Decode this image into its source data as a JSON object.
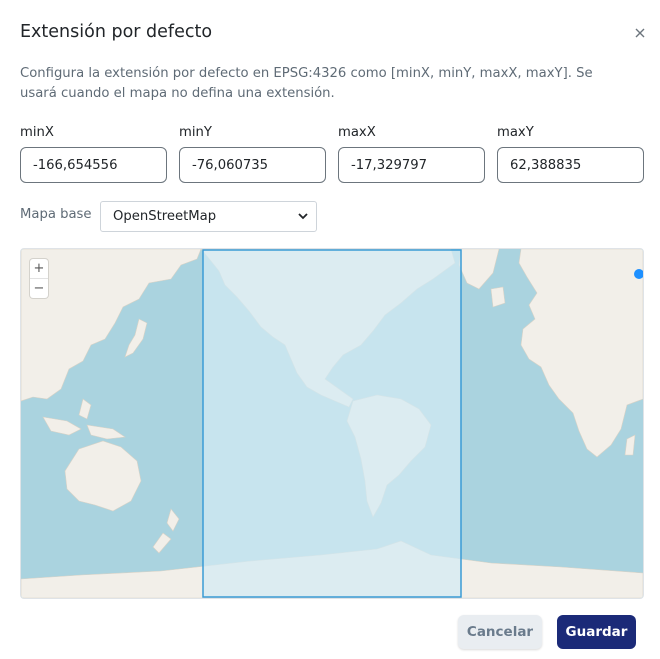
{
  "dialog": {
    "title": "Extensión por defecto",
    "description": "Configura la extensión por defecto en EPSG:4326 como [minX, minY, maxX, maxY]. Se usará cuando el mapa no defina una extensión."
  },
  "fields": [
    {
      "label": "minX",
      "value": "-166,654556"
    },
    {
      "label": "minY",
      "value": "-76,060735"
    },
    {
      "label": "maxX",
      "value": "-17,329797"
    },
    {
      "label": "maxY",
      "value": "62,388835"
    }
  ],
  "basemap": {
    "label": "Mapa base",
    "selected": "OpenStreetMap"
  },
  "map": {
    "zoom_in": "+",
    "zoom_out": "−",
    "extent_color": "#3a9bd5"
  },
  "buttons": {
    "cancel": "Cancelar",
    "save": "Guardar"
  },
  "colors": {
    "primary": "#1b2a78",
    "ocean": "#aad3df",
    "land": "#f2efe9"
  }
}
